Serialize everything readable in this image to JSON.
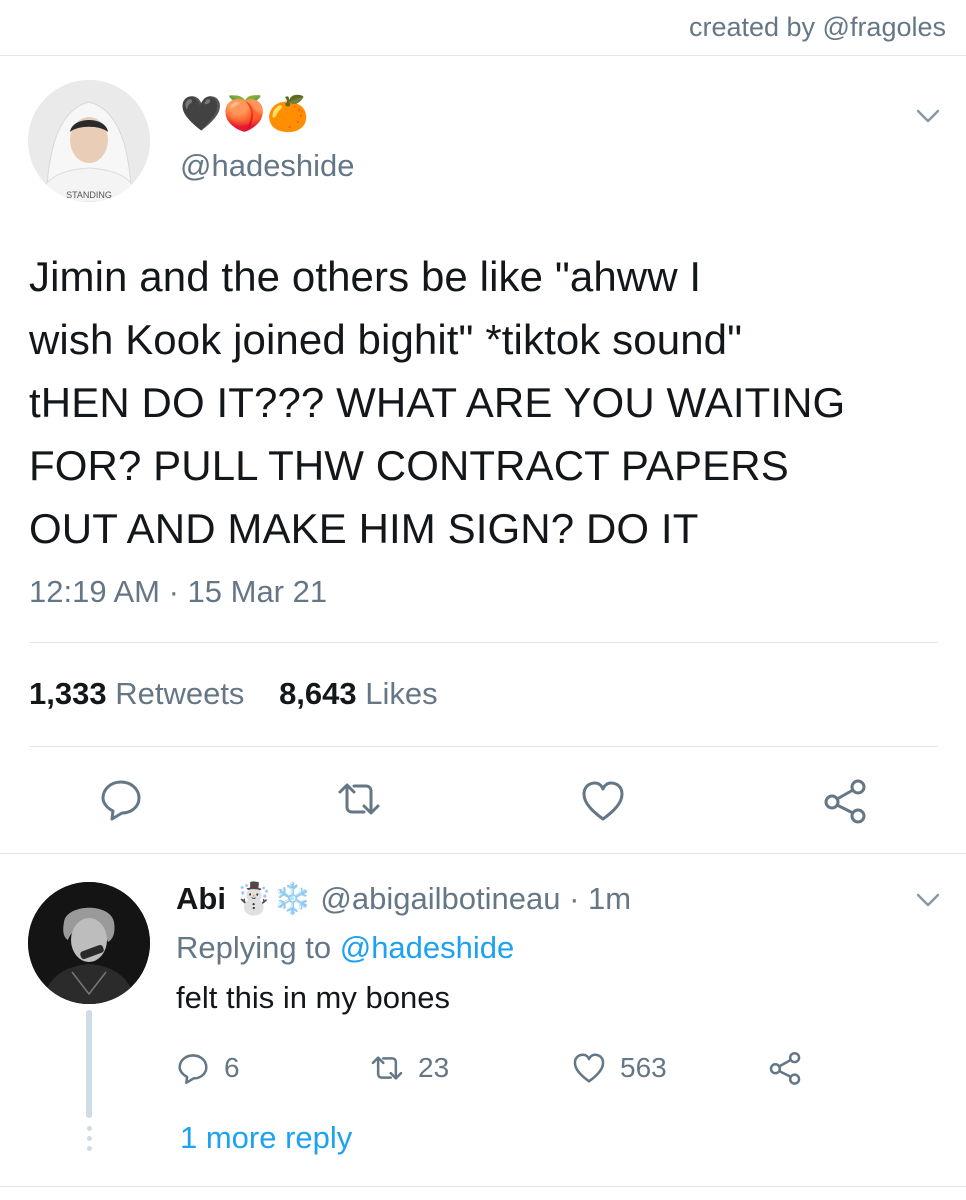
{
  "credit": "created by @fragoles",
  "tweet": {
    "emojis": "🖤🍑🍊",
    "handle": "@hadeshide",
    "text_lines": [
      "Jimin and the others be like \"ahww I",
      "wish Kook joined bighit\" *tiktok sound\"",
      "tHEN DO IT??? WHAT ARE YOU WAITING",
      "FOR? PULL THW CONTRACT PAPERS",
      "OUT AND MAKE HIM SIGN? DO IT"
    ],
    "timestamp": "12:19 AM · 15 Mar 21",
    "retweets_count": "1,333",
    "retweets_label": "Retweets",
    "likes_count": "8,643",
    "likes_label": "Likes",
    "avatar_caption": "STANDING"
  },
  "reply": {
    "name": "Abi",
    "name_emojis": "☃️❄️",
    "handle": "@abigailbotineau",
    "separator": "·",
    "time": "1m",
    "replying_prefix": "Replying to",
    "replying_handle": "@hadeshide",
    "text": "felt this in my bones",
    "reply_count": "6",
    "retweet_count": "23",
    "like_count": "563",
    "more_replies": "1 more reply"
  },
  "icons": {
    "main_actions": [
      "reply-icon",
      "retweet-icon",
      "like-icon",
      "share-icon"
    ],
    "caret": "chevron-down-icon",
    "icon_color": "#657786",
    "link_color": "#1da1f2"
  }
}
